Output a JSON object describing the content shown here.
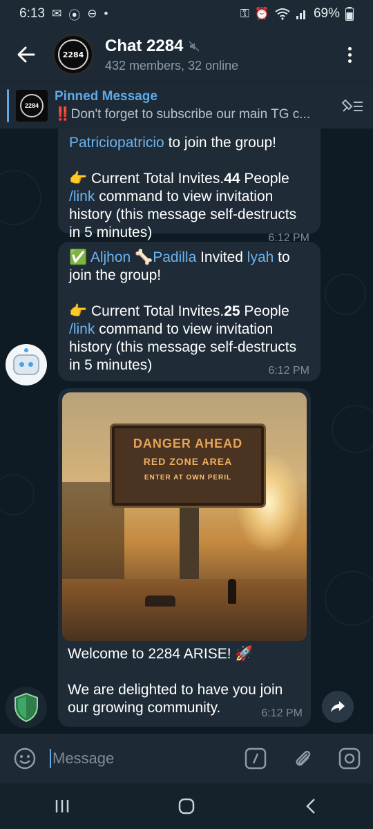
{
  "status_bar": {
    "time": "6:13",
    "battery": "69%"
  },
  "header": {
    "title": "Chat 2284",
    "subtitle": "432 members, 32 online",
    "avatar_text": "2284"
  },
  "pinned": {
    "title": "Pinned Message",
    "body": "‼️Don't forget to subscribe our main TG c...",
    "thumb_text": "2284"
  },
  "messages": {
    "m1": {
      "line1_link": "Patriciopatricio",
      "line1_rest": " to join the group!",
      "invites_prefix": "👉 Current Total Invites.",
      "invites_count": "44",
      "invites_suffix": " People",
      "link_cmd": "/link",
      "cmd_rest": " command to view invitation history (this message self-destructs in 5 minutes)",
      "time": "6:12 PM"
    },
    "m2": {
      "check": "✅",
      "inviter": "Aljhon 🦴Padilla",
      "invited_word": " Invited ",
      "invitee": "lyah",
      "rest": " to join the group!",
      "invites_prefix": "👉 Current Total Invites.",
      "invites_count": "25",
      "invites_suffix": " People",
      "link_cmd": "/link",
      "cmd_rest": " command to view invitation history (this message self-destructs in 5 minutes)",
      "time": "6:12 PM"
    },
    "m3": {
      "image_text_1": "DANGER AHEAD",
      "image_text_2": "RED ZONE AREA",
      "image_text_3": "ENTER AT OWN PERIL",
      "caption_1": "Welcome to 2284 ARISE! 🚀",
      "caption_2": "We are delighted to have you join our growing community.",
      "time": "6:12 PM"
    }
  },
  "composer": {
    "placeholder": "Message"
  },
  "colors": {
    "accent": "#5ea9e6",
    "bubble": "#1f2c37",
    "background": "#0f1b24",
    "header": "#1d2a35"
  }
}
